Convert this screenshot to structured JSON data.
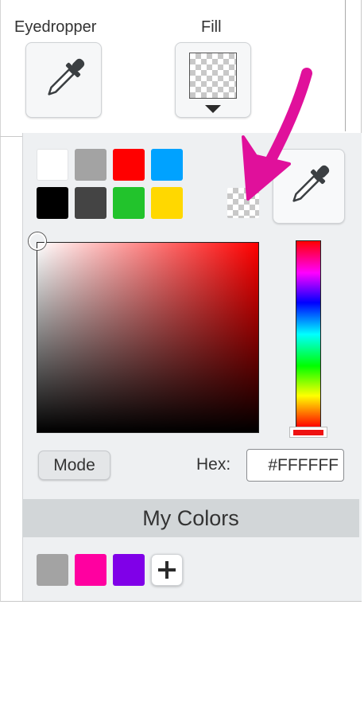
{
  "tools": {
    "eyedropper_label": "Eyedropper",
    "fill_label": "Fill"
  },
  "preset_swatches": [
    {
      "name": "white",
      "color": "#ffffff"
    },
    {
      "name": "gray",
      "color": "#a3a3a3"
    },
    {
      "name": "red",
      "color": "#ff0000"
    },
    {
      "name": "blue",
      "color": "#00a2ff"
    },
    {
      "name": "black",
      "color": "#000000"
    },
    {
      "name": "dark-gray",
      "color": "#444444"
    },
    {
      "name": "green",
      "color": "#22c32c"
    },
    {
      "name": "yellow",
      "color": "#ffd800"
    }
  ],
  "picker": {
    "mode_label": "Mode",
    "hex_label": "Hex:",
    "hex_value": "#FFFFFF",
    "hue_color": "#ff0000"
  },
  "my_colors": {
    "title": "My Colors",
    "swatches": [
      {
        "name": "gray",
        "color": "#a3a3a3"
      },
      {
        "name": "magenta",
        "color": "#ff00a0"
      },
      {
        "name": "purple",
        "color": "#8000e8"
      }
    ]
  },
  "annotation": {
    "arrow_color": "#e0109b"
  },
  "icons": {
    "eyedropper": "eyedropper-icon",
    "add": "plus-icon",
    "dropdown": "caret-down-icon"
  }
}
